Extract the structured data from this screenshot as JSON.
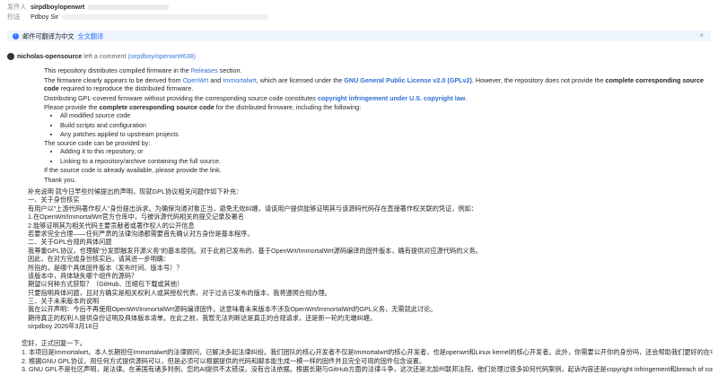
{
  "header": {
    "from_label": "发件人",
    "from_value": "sirpdboy/openwrt",
    "to_label": "抄送",
    "to_value": "Pdboy Sir"
  },
  "translate_bar": {
    "text": "邮件可翻译为中文",
    "link": "全文翻译",
    "close": "×"
  },
  "comment": {
    "author": "nicholas-opensource",
    "action": "left a comment",
    "ref": "(sirpdboy/openwrt#638)"
  },
  "quote": {
    "p1_a": "This repository distributes compiled firmware in the ",
    "p1_link": "Releases",
    "p1_b": " section.",
    "p2_a": "The firmware clearly appears to be derived from ",
    "p2_l1": "OpenWrt",
    "p2_b": " and ",
    "p2_l2": "Immortalwrt",
    "p2_c": ", which are licensed under the ",
    "p2_l3": "GNU General Public License v2.0 (GPLv2)",
    "p2_d": ". However, the repository does not provide the ",
    "p2_bold": "complete corresponding source code",
    "p2_e": " required to reproduce the distributed firmware.",
    "p3_a": "Distributing GPL-covered firmware without providing the corresponding source code constitutes ",
    "p3_link": "copyright infringement under U.S. copyright law",
    "p3_b": ".",
    "p4_a": "Please provide the ",
    "p4_bold": "complete corresponding source code",
    "p4_b": " for the distributed firmware, including the following:",
    "list1": [
      "All modified source code",
      "Build scripts and configuration",
      "Any patches applied to upstream projects"
    ],
    "p5": "The source code can be provided by:",
    "list2": [
      "Adding it to this repository, or",
      "Linking to a repository/archive containing the full source."
    ],
    "p6": "If the source code is already available, please provide the link.",
    "p7": "Thank you."
  },
  "zh_lines": [
    "补充说明 就今日早些时候提出的声明，现就GPL协议相关问题作如下补充：",
    "一、关于身份核实",
    "有用户以\"上游代码著作权人\"身份提出诉求。为确保沟通对象正当，避免无效纠缠，请该用户提供能够证明其与该源码代码存在直接著作权关联的凭证，例如：",
    "1.在OpenWrt/ImmortalWrt官方仓库中，与被诉源代码相关的提交记录及署名",
    "2.能够证明其为相关代码主要贡献者或著作权人的公开信息",
    "若要求完全合理——任何严肃的法律沟通都需要首先确认对方身份是基本程序。",
    "二、关于GPL合规的具体问题",
    "我尊重GPL协议，也理解\"分发即触发开源义务\"的基本原则。对于此前已发布的、基于OpenWrt/ImmortalWrt源码编译的固件版本，确有提供对应源代码的义务。",
    "因此，在对方完成身份核实后，请其进一步明确：",
    "所指的，是哪个具体固件版本（发布时间、版本号）？",
    "该版本中，具体缺失哪个组件的源码？",
    "期望以何种方式获取？（GitHub、压缩包下载或其他）",
    "只要指明具体问题，且对方确实是相关权利人或其授权代表，对于过去已发布的版本，我将遵照合规办理。",
    "三、关于未来版本的说明",
    "我在公开声明：今后不再使用OpenWrt/ImmortalWrt源码编译固件。这意味着未来版本不涉及OpenWrt/ImmortalWrt的GPL义务，无需就此讨论。",
    "期待真正的权利人提供身份证明及具体版本清单。在此之前，我暂无法判断这是真正的合规请求，还是新一轮的无端纠缠。",
    "sirpdboy 2026年3月16日"
  ],
  "reply": {
    "greeting": "您好，正式回复一下。",
    "items": [
      "1. 本项目是Immortalwrt。本人长期担任Immortalwrt的法律顾问，已解决多起法律纠纷。我们团队的核心开发者不仅是Immortalwrt的核心开发者，也是openwrt和Linux kernel的核心开发者。此外，你需要公开你的身份吗，还会帮助我们更好的在中国大陆开展法律行动。",
      "2. 根据GNU GPL协议，用任何方式提供源码可以，但是必须可以根据提供的代码和脚本能生成一模一样的固件并且完全可用的固件包含设置。",
      "3. GNU GPL不是社区声明，是法律。在美国有诸多判例，您的AI提供不太错误，没有合法依据。根据长期与GitHub方面的法律斗争，这次还是北加州联邦法院，他们处理过很多如何代码案例，起诉内容还是copyright infringement和breach of contract。"
    ]
  }
}
